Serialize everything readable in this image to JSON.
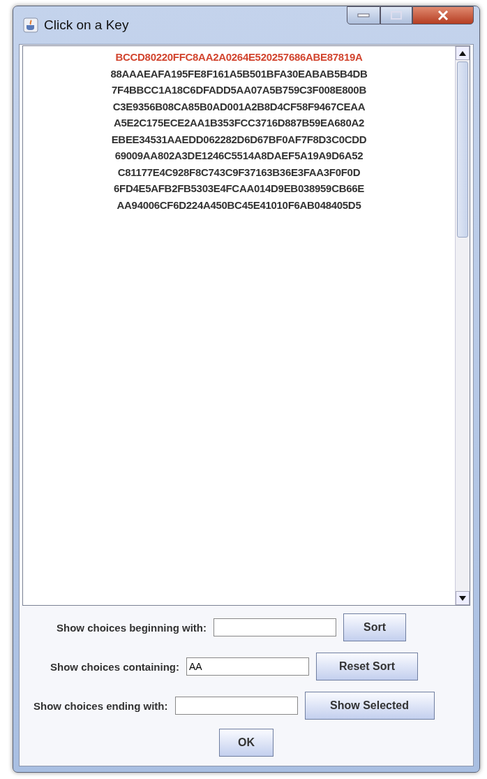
{
  "window": {
    "title": "Click on a Key"
  },
  "keys": [
    {
      "text": "BCCD80220FFC8AA2A0264E520257686ABE87819A",
      "selected": true
    },
    {
      "text": "88AAAEAFA195FE8F161A5B501BFA30EABAB5B4DB",
      "selected": false
    },
    {
      "text": "7F4BBCC1A18C6DFADD5AA07A5B759C3F008E800B",
      "selected": false
    },
    {
      "text": "C3E9356B08CA85B0AD001A2B8D4CF58F9467CEAA",
      "selected": false
    },
    {
      "text": "A5E2C175ECE2AA1B353FCC3716D887B59EA680A2",
      "selected": false
    },
    {
      "text": "EBEE34531AAEDD062282D6D67BF0AF7F8D3C0CDD",
      "selected": false
    },
    {
      "text": "69009AA802A3DE1246C5514A8DAEF5A19A9D6A52",
      "selected": false
    },
    {
      "text": "C81177E4C928F8C743C9F37163B36E3FAA3F0F0D",
      "selected": false
    },
    {
      "text": "6FD4E5AFB2FB5303E4FCAA014D9EB038959CB66E",
      "selected": false
    },
    {
      "text": "AA94006CF6D224A450BC45E41010F6AB048405D5",
      "selected": false
    }
  ],
  "filters": [
    {
      "label": "Show choices beginning with:",
      "button": "Sort"
    },
    {
      "label": "Show choices containing:",
      "value": "AA",
      "button": "Reset Sort"
    },
    {
      "label": "Show choices ending with:",
      "button": "Show Selected"
    }
  ],
  "ok_button": "OK"
}
